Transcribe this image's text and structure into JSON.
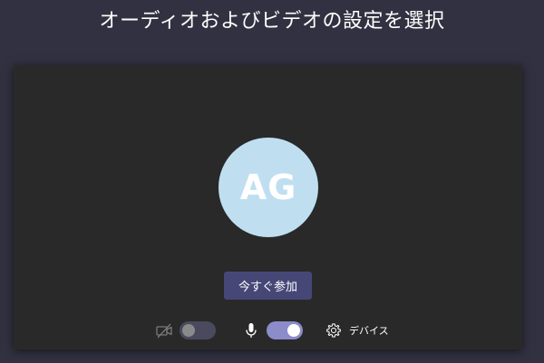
{
  "header": {
    "title": "オーディオおよびビデオの設定を選択"
  },
  "preview": {
    "avatar_initials": "AG",
    "avatar_color": "#bfdff1"
  },
  "join_button": {
    "label": "今すぐ参加",
    "color": "#474777"
  },
  "controls": {
    "camera": {
      "icon": "camera-off-icon",
      "enabled": false
    },
    "microphone": {
      "icon": "microphone-icon",
      "enabled": true,
      "toggle_color": "#8b8cc9"
    },
    "devices": {
      "icon": "gear-icon",
      "label": "デバイス"
    }
  },
  "colors": {
    "page_background": "#323141",
    "panel_background": "#292929",
    "text": "#ffffff"
  }
}
